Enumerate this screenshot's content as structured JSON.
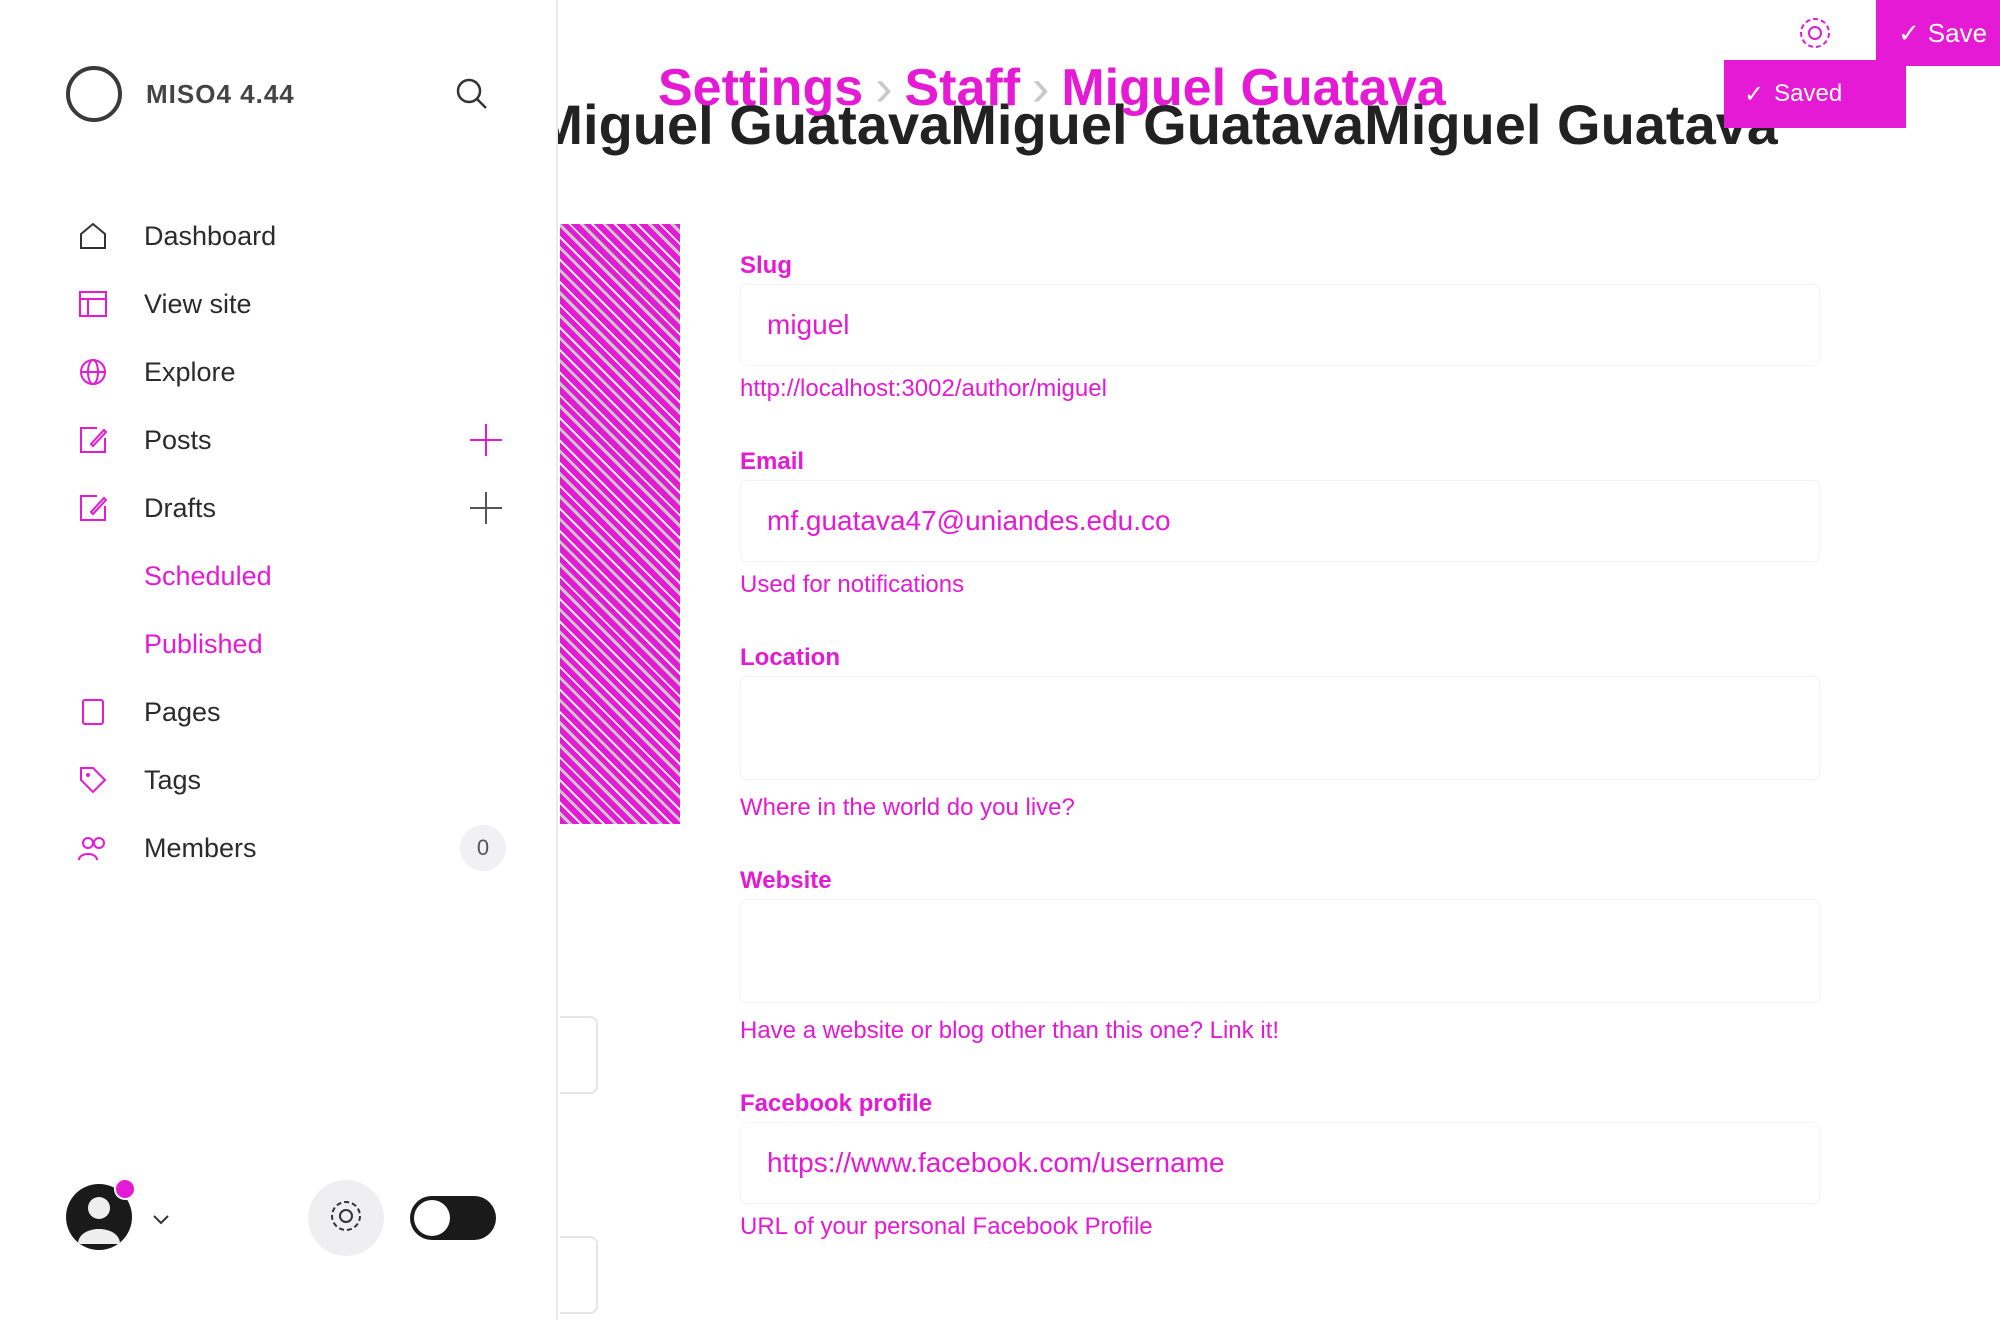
{
  "sidebar": {
    "brand_name": "MISO4 4.44",
    "items": [
      {
        "label": "Dashboard",
        "icon": "home-icon"
      },
      {
        "label": "View site",
        "icon": "layout-icon"
      },
      {
        "label": "Explore",
        "icon": "globe-icon"
      },
      {
        "label": "Posts",
        "icon": "edit-icon"
      },
      {
        "label": "Drafts",
        "icon": "edit-icon"
      },
      {
        "label": "Scheduled"
      },
      {
        "label": "Published"
      },
      {
        "label": "Pages",
        "icon": "pages-icon"
      },
      {
        "label": "Tags",
        "icon": "tag-icon"
      },
      {
        "label": "Members",
        "icon": "members-icon",
        "count": "0"
      }
    ]
  },
  "header": {
    "breadcrumb": [
      "Settings",
      "Staff",
      "Miguel Guatava"
    ],
    "title": "Miguel GuatavaMiguel GuatavaMiguel Guatava",
    "save_label": "Save",
    "saved_label": "Saved"
  },
  "form": {
    "slug": {
      "label": "Slug",
      "value": "miguel",
      "hint": "http://localhost:3002/author/miguel"
    },
    "email": {
      "label": "Email",
      "value": "mf.guatava47@uniandes.edu.co",
      "hint": "Used for notifications"
    },
    "location": {
      "label": "Location",
      "value": "",
      "hint": "Where in the world do you live?"
    },
    "website": {
      "label": "Website",
      "value": "",
      "hint": "Have a website or blog other than this one? Link it!"
    },
    "facebook": {
      "label": "Facebook profile",
      "placeholder": "https://www.facebook.com/username",
      "hint": "URL of your personal Facebook Profile"
    }
  },
  "colors": {
    "accent": "#e41ad5",
    "text": "#15212a",
    "muted": "#c8c8cc"
  }
}
